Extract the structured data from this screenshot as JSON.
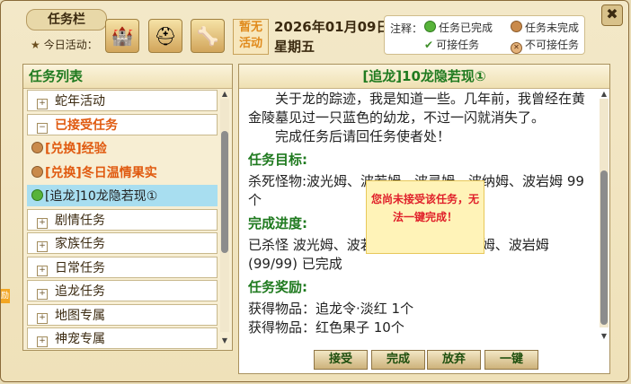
{
  "window": {
    "title": "任务栏",
    "close_symbol": "✖",
    "today_label": "今日活动：",
    "activity_icons": [
      "castle-icon",
      "knight-helmet-icon",
      "bone-icon"
    ],
    "no_activity": "暂无活动",
    "date": "2026年01月09日",
    "weekday": "星期五"
  },
  "legend": {
    "label": "注释：",
    "items": [
      {
        "text": "任务已完成",
        "icon": "green-dot-icon",
        "color": "#57b33a"
      },
      {
        "text": "任务未完成",
        "icon": "orange-dot-icon",
        "color": "#c98a4b"
      },
      {
        "text": "可接任务",
        "icon": "check-icon",
        "color": "#3f8f2a"
      },
      {
        "text": "不可接任务",
        "icon": "x-mark-icon",
        "color": "#9b5a2a"
      }
    ]
  },
  "task_list": {
    "header": "任务列表",
    "items": [
      {
        "label": "蛇年活动",
        "state": "+"
      },
      {
        "label": "已接受任务",
        "state": "−"
      },
      {
        "label": "[兑换]经验",
        "status": "orange"
      },
      {
        "label": "[兑换]冬日温情果实",
        "status": "orange"
      },
      {
        "label": "[追龙]10龙隐若现①",
        "status": "green"
      },
      {
        "label": "剧情任务",
        "state": "+"
      },
      {
        "label": "家族任务",
        "state": "+"
      },
      {
        "label": "日常任务",
        "state": "+"
      },
      {
        "label": "追龙任务",
        "state": "+"
      },
      {
        "label": "地图专属",
        "state": "+"
      },
      {
        "label": "神宠专属",
        "state": "+"
      }
    ]
  },
  "detail": {
    "title": "[追龙]10龙隐若现①",
    "description_1": "关于龙的踪迹，我是知道一些。几年前，我曾经在黄金陵墓见过一只蓝色的幼龙，不过一闪就消失了。",
    "description_2": "完成任务后请回任务使者处！",
    "goal_header": "任务目标:",
    "goal_text": "杀死怪物:波光姆、波若姆、波灵姆、波纳姆、波岩姆 99个",
    "progress_header": "完成进度:",
    "progress_text": "已杀怪 波光姆、波若姆、波灵姆、波纳姆、波岩姆 (99/99) 已完成",
    "reward_header": "任务奖励:",
    "reward_1": "获得物品：追龙令·淡红 1个",
    "reward_2": "获得物品：红色果子 10个"
  },
  "toast": {
    "text": "您尚未接受该任务，无法一键完成！"
  },
  "buttons": {
    "accept": "接受",
    "complete": "完成",
    "abandon": "放弃",
    "one_click": "一键"
  },
  "side_tab": "励"
}
